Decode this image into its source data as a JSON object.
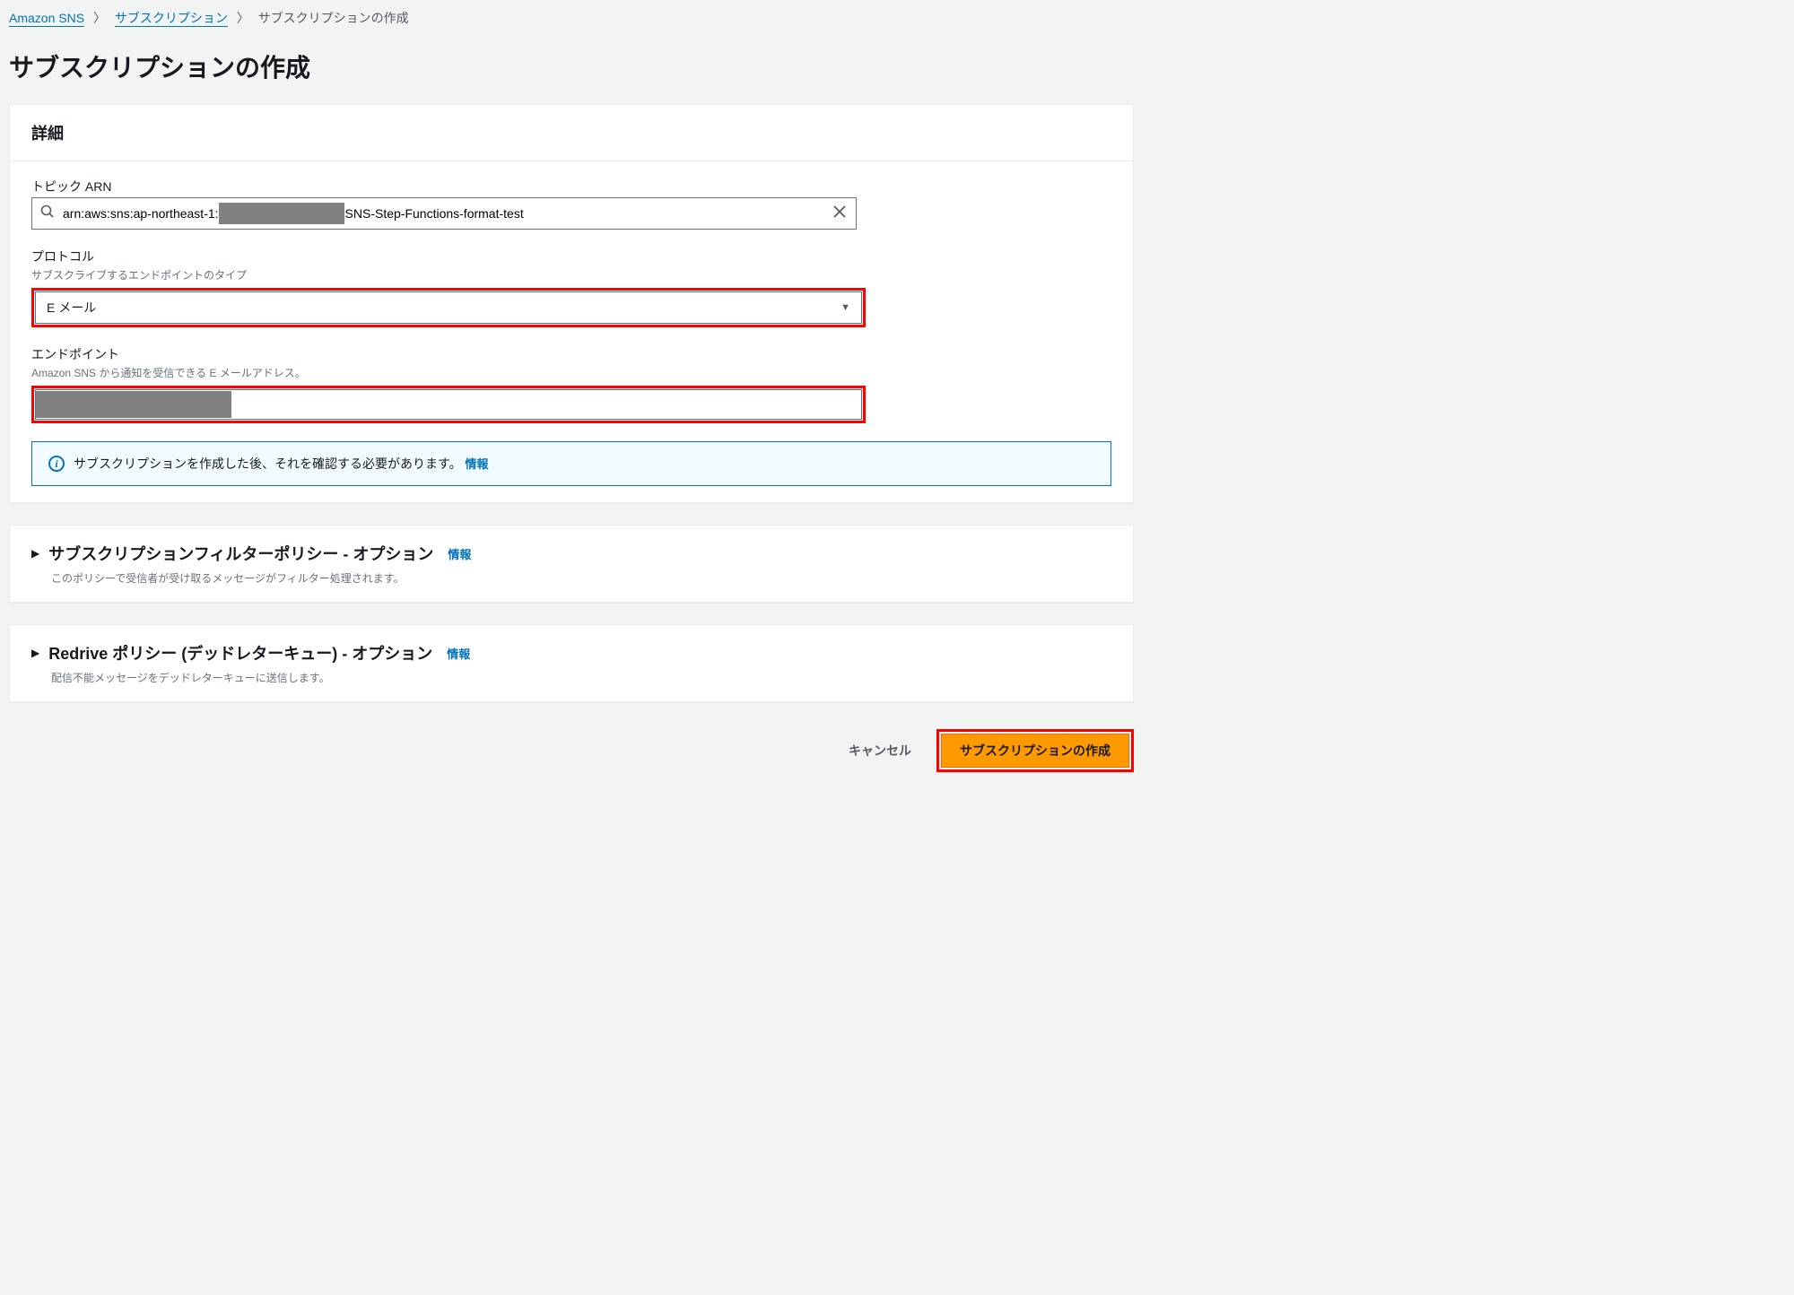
{
  "breadcrumb": {
    "service": "Amazon SNS",
    "section": "サブスクリプション",
    "current": "サブスクリプションの作成"
  },
  "page": {
    "title": "サブスクリプションの作成"
  },
  "details": {
    "heading": "詳細",
    "topic_arn": {
      "label": "トピック ARN",
      "prefix": "arn:aws:sns:ap-northeast-1:",
      "suffix": "SNS-Step-Functions-format-test"
    },
    "protocol": {
      "label": "プロトコル",
      "hint": "サブスクライブするエンドポイントのタイプ",
      "value": "E メール"
    },
    "endpoint": {
      "label": "エンドポイント",
      "hint": "Amazon SNS から通知を受信できる E メールアドレス。"
    },
    "confirm_alert": {
      "message": "サブスクリプションを作成した後、それを確認する必要があります。",
      "info_label": "情報"
    }
  },
  "filter_policy": {
    "title": "サブスクリプションフィルターポリシー - オプション",
    "info_label": "情報",
    "description": "このポリシーで受信者が受け取るメッセージがフィルター処理されます。"
  },
  "redrive_policy": {
    "title": "Redrive ポリシー (デッドレターキュー) - オプション",
    "info_label": "情報",
    "description": "配信不能メッセージをデッドレターキューに送信します。"
  },
  "actions": {
    "cancel": "キャンセル",
    "create": "サブスクリプションの作成"
  }
}
